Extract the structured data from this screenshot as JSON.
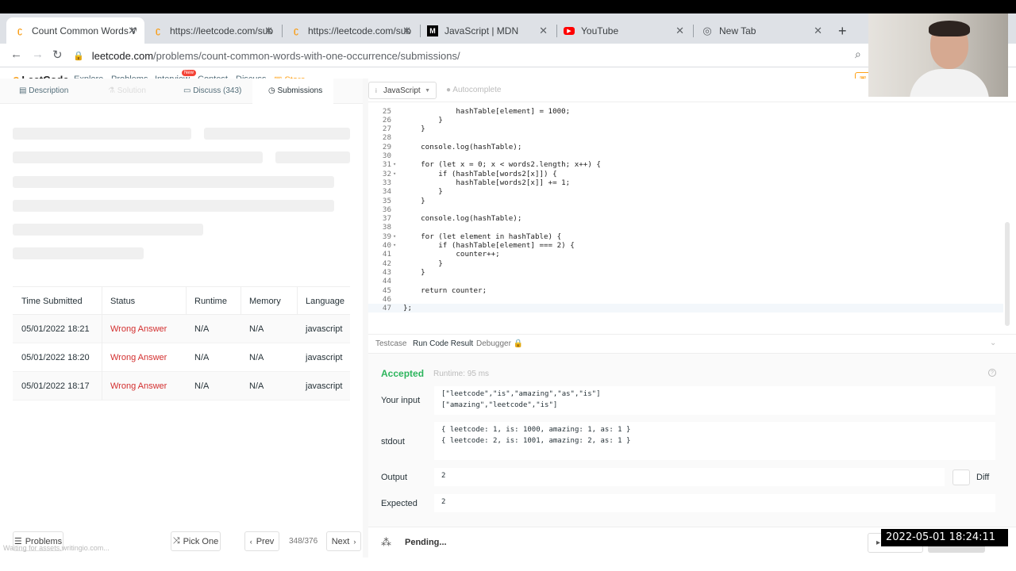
{
  "browser": {
    "tabs": [
      {
        "title": "Count Common Words Wi"
      },
      {
        "title": "https://leetcode.com/subm"
      },
      {
        "title": "https://leetcode.com/subm"
      },
      {
        "title": "JavaScript | MDN"
      },
      {
        "title": "YouTube"
      },
      {
        "title": "New Tab"
      }
    ],
    "url_host": "leetcode.com",
    "url_path": "/problems/count-common-words-with-one-occurrence/submissions/",
    "newtab_glyph": "+"
  },
  "nav": {
    "logo": "LeetCode",
    "links": [
      "Explore",
      "Problems",
      "Interview",
      "Contest",
      "Discuss",
      "Store"
    ],
    "new_badge": "New"
  },
  "left": {
    "tabs": [
      "Description",
      "Solution",
      "Discuss (343)",
      "Submissions"
    ],
    "table": {
      "headers": [
        "Time Submitted",
        "Status",
        "Runtime",
        "Memory",
        "Language"
      ],
      "rows": [
        {
          "time": "05/01/2022 18:21",
          "status": "Wrong Answer",
          "runtime": "N/A",
          "memory": "N/A",
          "language": "javascript"
        },
        {
          "time": "05/01/2022 18:20",
          "status": "Wrong Answer",
          "runtime": "N/A",
          "memory": "N/A",
          "language": "javascript"
        },
        {
          "time": "05/01/2022 18:17",
          "status": "Wrong Answer",
          "runtime": "N/A",
          "memory": "N/A",
          "language": "javascript"
        }
      ]
    },
    "footer": {
      "problems": "Problems",
      "pick_one": "Pick One",
      "prev": "Prev",
      "page": "348/376",
      "next": "Next"
    },
    "status_text": "Waiting for assets.writingio.com..."
  },
  "editor": {
    "language": "JavaScript",
    "autocomplete": "Autocomplete",
    "lines": [
      {
        "n": "25",
        "code": "            hashTable[element] = 1000;"
      },
      {
        "n": "26",
        "code": "        }"
      },
      {
        "n": "27",
        "code": "    }"
      },
      {
        "n": "28",
        "code": ""
      },
      {
        "n": "29",
        "code": "    console.log(hashTable);"
      },
      {
        "n": "30",
        "code": ""
      },
      {
        "n": "31",
        "code": "    for (let x = 0; x < words2.length; x++) {",
        "fold": true
      },
      {
        "n": "32",
        "code": "        if (hashTable[words2[x]]) {",
        "fold": true
      },
      {
        "n": "33",
        "code": "            hashTable[words2[x]] += 1;"
      },
      {
        "n": "34",
        "code": "        }"
      },
      {
        "n": "35",
        "code": "    }"
      },
      {
        "n": "36",
        "code": ""
      },
      {
        "n": "37",
        "code": "    console.log(hashTable);"
      },
      {
        "n": "38",
        "code": ""
      },
      {
        "n": "39",
        "code": "    for (let element in hashTable) {",
        "fold": true
      },
      {
        "n": "40",
        "code": "        if (hashTable[element] === 2) {",
        "fold": true
      },
      {
        "n": "41",
        "code": "            counter++;"
      },
      {
        "n": "42",
        "code": "        }"
      },
      {
        "n": "43",
        "code": "    }"
      },
      {
        "n": "44",
        "code": ""
      },
      {
        "n": "45",
        "code": "    return counter;"
      },
      {
        "n": "46",
        "code": ""
      },
      {
        "n": "47",
        "code": "};"
      }
    ]
  },
  "console": {
    "tabs": [
      "Testcase",
      "Run Code Result",
      "Debugger"
    ],
    "status": "Accepted",
    "runtime": "Runtime: 95 ms",
    "labels": {
      "input": "Your input",
      "stdout": "stdout",
      "output": "Output",
      "expected": "Expected",
      "diff": "Diff"
    },
    "input": "[\"leetcode\",\"is\",\"amazing\",\"as\",\"is\"]\n[\"amazing\",\"leetcode\",\"is\"]",
    "stdout": "{ leetcode: 1, is: 1000, amazing: 1, as: 1 }\n{ leetcode: 2, is: 1001, amazing: 2, as: 1 }",
    "output": "2",
    "expected": "2",
    "pending": "Pending..."
  },
  "overlay": {
    "timestamp": "2022-05-01  18:24:11"
  }
}
